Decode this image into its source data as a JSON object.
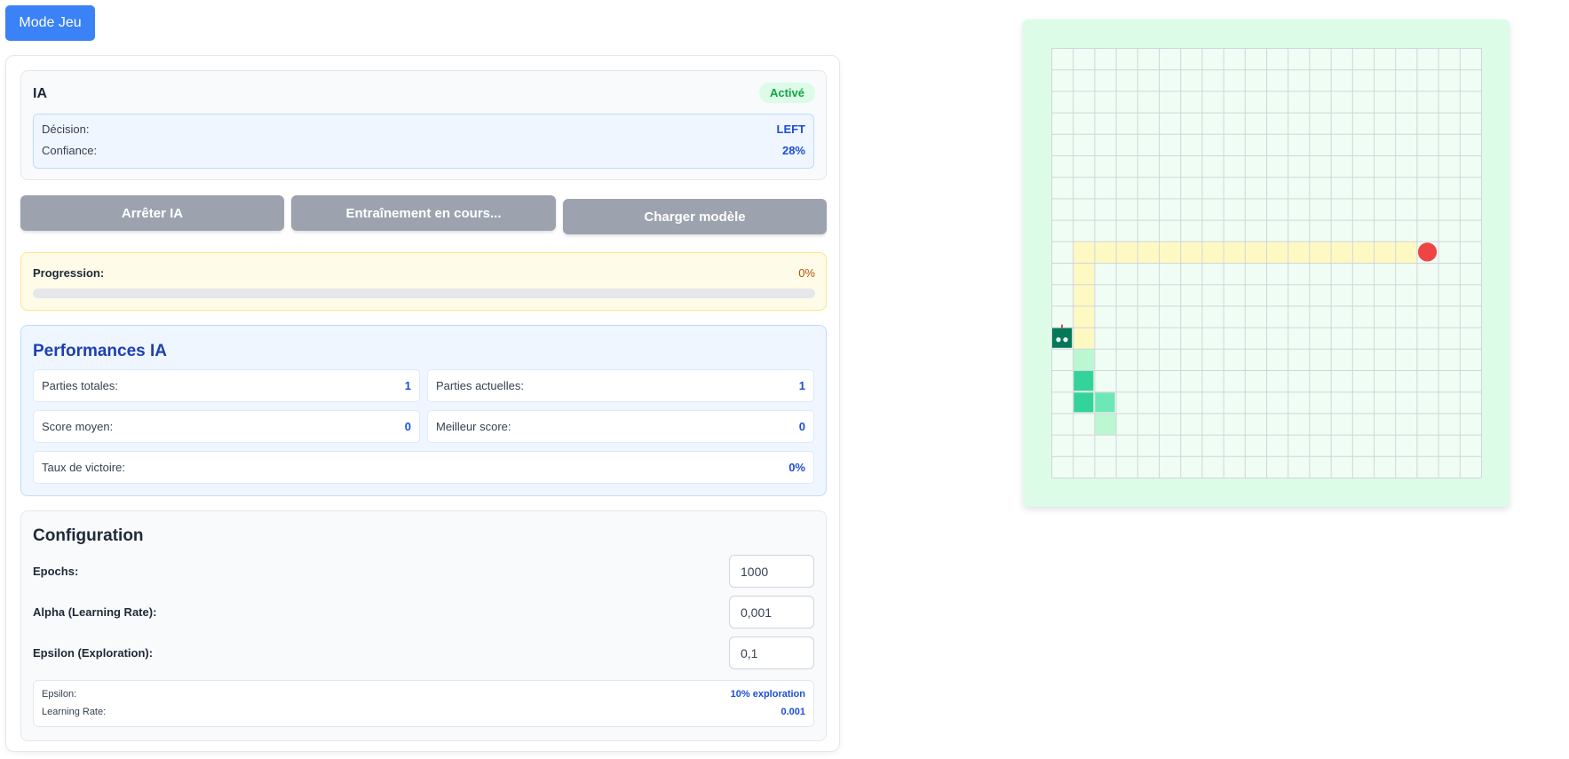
{
  "mode_button": "Mode Jeu",
  "ai": {
    "title": "IA",
    "status": "Activé",
    "decision_label": "Décision:",
    "decision_value": "LEFT",
    "confidence_label": "Confiance:",
    "confidence_value": "28%"
  },
  "controls": {
    "stop": "Arrêter IA",
    "training": "Entraînement en cours...",
    "load": "Charger modèle"
  },
  "progress": {
    "label": "Progression:",
    "value_text": "0%",
    "fraction": 0
  },
  "performance": {
    "title": "Performances IA",
    "total_games_label": "Parties totales:",
    "total_games": "1",
    "current_games_label": "Parties actuelles:",
    "current_games": "1",
    "avg_score_label": "Score moyen:",
    "avg_score": "0",
    "best_score_label": "Meilleur score:",
    "best_score": "0",
    "win_rate_label": "Taux de victoire:",
    "win_rate": "0%"
  },
  "config": {
    "title": "Configuration",
    "epochs_label": "Epochs:",
    "epochs_value": "1000",
    "alpha_label": "Alpha (Learning Rate):",
    "alpha_value": "0,001",
    "epsilon_label": "Epsilon (Exploration):",
    "epsilon_value": "0,1",
    "info_epsilon_label": "Epsilon:",
    "info_epsilon_value": "10% exploration",
    "info_lr_label": "Learning Rate:",
    "info_lr_value": "0.001"
  },
  "game": {
    "grid_cols": 20,
    "grid_rows": 20,
    "colors": {
      "board_bg": "#dcfce7",
      "cell": "#f0fdf4",
      "grid_line": "#d1d5db",
      "path": "#fef9c3",
      "food": "#ef4444",
      "snake_head": "#047857",
      "snake_body": "#34d399",
      "snake_tail": "#6ee7b7",
      "snake_fade": "#bbf7d0"
    },
    "food": {
      "col": 17,
      "row": 9
    },
    "snake_head": {
      "col": 0,
      "row": 13
    },
    "snake_body": [
      {
        "col": 1,
        "row": 15,
        "shade": "snake_body"
      },
      {
        "col": 1,
        "row": 16,
        "shade": "snake_body"
      },
      {
        "col": 2,
        "row": 16,
        "shade": "snake_tail"
      }
    ],
    "snake_fade": [
      {
        "col": 1,
        "row": 14
      },
      {
        "col": 2,
        "row": 17
      }
    ],
    "path": [
      {
        "col": 1,
        "row": 9
      },
      {
        "col": 2,
        "row": 9
      },
      {
        "col": 3,
        "row": 9
      },
      {
        "col": 4,
        "row": 9
      },
      {
        "col": 5,
        "row": 9
      },
      {
        "col": 6,
        "row": 9
      },
      {
        "col": 7,
        "row": 9
      },
      {
        "col": 8,
        "row": 9
      },
      {
        "col": 9,
        "row": 9
      },
      {
        "col": 10,
        "row": 9
      },
      {
        "col": 11,
        "row": 9
      },
      {
        "col": 12,
        "row": 9
      },
      {
        "col": 13,
        "row": 9
      },
      {
        "col": 14,
        "row": 9
      },
      {
        "col": 15,
        "row": 9
      },
      {
        "col": 16,
        "row": 9
      },
      {
        "col": 1,
        "row": 10
      },
      {
        "col": 1,
        "row": 11
      },
      {
        "col": 1,
        "row": 12
      },
      {
        "col": 1,
        "row": 13
      }
    ]
  }
}
